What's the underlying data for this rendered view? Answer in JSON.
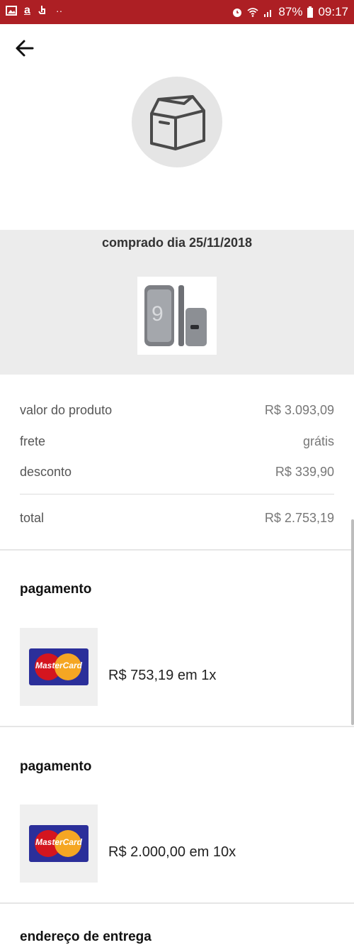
{
  "status_bar": {
    "battery": "87%",
    "time": "09:17",
    "colors": {
      "background": "#ad1f24"
    }
  },
  "nav": {
    "back_icon": "arrow-left-icon"
  },
  "order": {
    "icon": "package-box-icon",
    "purchase_date": "comprado dia 25/11/2018"
  },
  "summary": {
    "rows": [
      {
        "label": "valor do produto",
        "value": "R$ 3.093,09"
      },
      {
        "label": "frete",
        "value": "grátis"
      },
      {
        "label": "desconto",
        "value": "R$ 339,90"
      }
    ],
    "total_label": "total",
    "total_value": "R$ 2.753,19"
  },
  "payments": [
    {
      "title": "pagamento",
      "card_brand": "MasterCard",
      "amount": "R$ 753,19 em 1x"
    },
    {
      "title": "pagamento",
      "card_brand": "MasterCard",
      "amount": "R$ 2.000,00 em 10x"
    }
  ],
  "delivery": {
    "title": "endereço de entrega"
  }
}
